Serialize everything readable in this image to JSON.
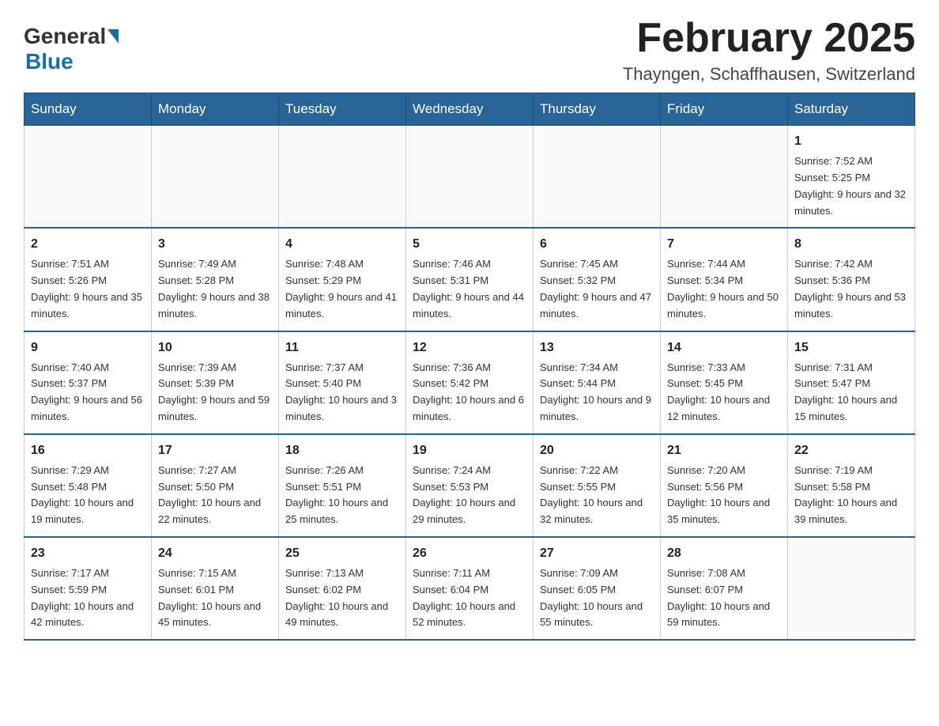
{
  "header": {
    "logo_general": "General",
    "logo_blue": "Blue",
    "month_title": "February 2025",
    "location": "Thayngen, Schaffhausen, Switzerland"
  },
  "days_of_week": [
    "Sunday",
    "Monday",
    "Tuesday",
    "Wednesday",
    "Thursday",
    "Friday",
    "Saturday"
  ],
  "weeks": [
    [
      {
        "day": "",
        "sunrise": "",
        "sunset": "",
        "daylight": ""
      },
      {
        "day": "",
        "sunrise": "",
        "sunset": "",
        "daylight": ""
      },
      {
        "day": "",
        "sunrise": "",
        "sunset": "",
        "daylight": ""
      },
      {
        "day": "",
        "sunrise": "",
        "sunset": "",
        "daylight": ""
      },
      {
        "day": "",
        "sunrise": "",
        "sunset": "",
        "daylight": ""
      },
      {
        "day": "",
        "sunrise": "",
        "sunset": "",
        "daylight": ""
      },
      {
        "day": "1",
        "sunrise": "Sunrise: 7:52 AM",
        "sunset": "Sunset: 5:25 PM",
        "daylight": "Daylight: 9 hours and 32 minutes."
      }
    ],
    [
      {
        "day": "2",
        "sunrise": "Sunrise: 7:51 AM",
        "sunset": "Sunset: 5:26 PM",
        "daylight": "Daylight: 9 hours and 35 minutes."
      },
      {
        "day": "3",
        "sunrise": "Sunrise: 7:49 AM",
        "sunset": "Sunset: 5:28 PM",
        "daylight": "Daylight: 9 hours and 38 minutes."
      },
      {
        "day": "4",
        "sunrise": "Sunrise: 7:48 AM",
        "sunset": "Sunset: 5:29 PM",
        "daylight": "Daylight: 9 hours and 41 minutes."
      },
      {
        "day": "5",
        "sunrise": "Sunrise: 7:46 AM",
        "sunset": "Sunset: 5:31 PM",
        "daylight": "Daylight: 9 hours and 44 minutes."
      },
      {
        "day": "6",
        "sunrise": "Sunrise: 7:45 AM",
        "sunset": "Sunset: 5:32 PM",
        "daylight": "Daylight: 9 hours and 47 minutes."
      },
      {
        "day": "7",
        "sunrise": "Sunrise: 7:44 AM",
        "sunset": "Sunset: 5:34 PM",
        "daylight": "Daylight: 9 hours and 50 minutes."
      },
      {
        "day": "8",
        "sunrise": "Sunrise: 7:42 AM",
        "sunset": "Sunset: 5:36 PM",
        "daylight": "Daylight: 9 hours and 53 minutes."
      }
    ],
    [
      {
        "day": "9",
        "sunrise": "Sunrise: 7:40 AM",
        "sunset": "Sunset: 5:37 PM",
        "daylight": "Daylight: 9 hours and 56 minutes."
      },
      {
        "day": "10",
        "sunrise": "Sunrise: 7:39 AM",
        "sunset": "Sunset: 5:39 PM",
        "daylight": "Daylight: 9 hours and 59 minutes."
      },
      {
        "day": "11",
        "sunrise": "Sunrise: 7:37 AM",
        "sunset": "Sunset: 5:40 PM",
        "daylight": "Daylight: 10 hours and 3 minutes."
      },
      {
        "day": "12",
        "sunrise": "Sunrise: 7:36 AM",
        "sunset": "Sunset: 5:42 PM",
        "daylight": "Daylight: 10 hours and 6 minutes."
      },
      {
        "day": "13",
        "sunrise": "Sunrise: 7:34 AM",
        "sunset": "Sunset: 5:44 PM",
        "daylight": "Daylight: 10 hours and 9 minutes."
      },
      {
        "day": "14",
        "sunrise": "Sunrise: 7:33 AM",
        "sunset": "Sunset: 5:45 PM",
        "daylight": "Daylight: 10 hours and 12 minutes."
      },
      {
        "day": "15",
        "sunrise": "Sunrise: 7:31 AM",
        "sunset": "Sunset: 5:47 PM",
        "daylight": "Daylight: 10 hours and 15 minutes."
      }
    ],
    [
      {
        "day": "16",
        "sunrise": "Sunrise: 7:29 AM",
        "sunset": "Sunset: 5:48 PM",
        "daylight": "Daylight: 10 hours and 19 minutes."
      },
      {
        "day": "17",
        "sunrise": "Sunrise: 7:27 AM",
        "sunset": "Sunset: 5:50 PM",
        "daylight": "Daylight: 10 hours and 22 minutes."
      },
      {
        "day": "18",
        "sunrise": "Sunrise: 7:26 AM",
        "sunset": "Sunset: 5:51 PM",
        "daylight": "Daylight: 10 hours and 25 minutes."
      },
      {
        "day": "19",
        "sunrise": "Sunrise: 7:24 AM",
        "sunset": "Sunset: 5:53 PM",
        "daylight": "Daylight: 10 hours and 29 minutes."
      },
      {
        "day": "20",
        "sunrise": "Sunrise: 7:22 AM",
        "sunset": "Sunset: 5:55 PM",
        "daylight": "Daylight: 10 hours and 32 minutes."
      },
      {
        "day": "21",
        "sunrise": "Sunrise: 7:20 AM",
        "sunset": "Sunset: 5:56 PM",
        "daylight": "Daylight: 10 hours and 35 minutes."
      },
      {
        "day": "22",
        "sunrise": "Sunrise: 7:19 AM",
        "sunset": "Sunset: 5:58 PM",
        "daylight": "Daylight: 10 hours and 39 minutes."
      }
    ],
    [
      {
        "day": "23",
        "sunrise": "Sunrise: 7:17 AM",
        "sunset": "Sunset: 5:59 PM",
        "daylight": "Daylight: 10 hours and 42 minutes."
      },
      {
        "day": "24",
        "sunrise": "Sunrise: 7:15 AM",
        "sunset": "Sunset: 6:01 PM",
        "daylight": "Daylight: 10 hours and 45 minutes."
      },
      {
        "day": "25",
        "sunrise": "Sunrise: 7:13 AM",
        "sunset": "Sunset: 6:02 PM",
        "daylight": "Daylight: 10 hours and 49 minutes."
      },
      {
        "day": "26",
        "sunrise": "Sunrise: 7:11 AM",
        "sunset": "Sunset: 6:04 PM",
        "daylight": "Daylight: 10 hours and 52 minutes."
      },
      {
        "day": "27",
        "sunrise": "Sunrise: 7:09 AM",
        "sunset": "Sunset: 6:05 PM",
        "daylight": "Daylight: 10 hours and 55 minutes."
      },
      {
        "day": "28",
        "sunrise": "Sunrise: 7:08 AM",
        "sunset": "Sunset: 6:07 PM",
        "daylight": "Daylight: 10 hours and 59 minutes."
      },
      {
        "day": "",
        "sunrise": "",
        "sunset": "",
        "daylight": ""
      }
    ]
  ]
}
